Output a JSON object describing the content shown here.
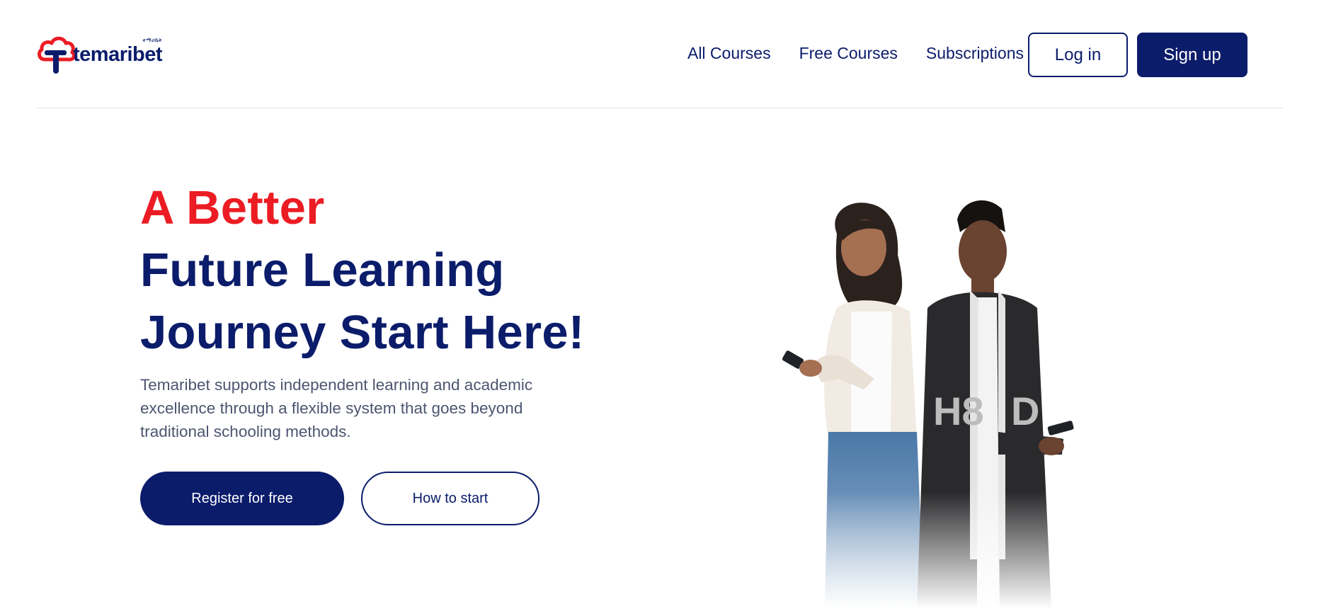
{
  "brand": {
    "name": "temaribet",
    "subtext": "ተማሪቤት",
    "colors": {
      "primary": "#0b1c6b",
      "accent": "#ec1c24"
    }
  },
  "nav": {
    "items": [
      {
        "label": "All Courses"
      },
      {
        "label": "Free Courses"
      },
      {
        "label": "Subscriptions"
      }
    ],
    "login_label": "Log in",
    "signup_label": "Sign up"
  },
  "hero": {
    "title_accent": "A Better",
    "title_line2": "Future Learning",
    "title_line3": "Journey Start Here!",
    "description": "Temaribet supports independent learning and academic excellence through a flexible system that goes beyond traditional schooling methods.",
    "primary_cta": "Register for free",
    "secondary_cta": "How to start",
    "image": {
      "alt": "students-with-phones",
      "left_jacket_text": "H8",
      "right_jacket_text": "D"
    }
  }
}
